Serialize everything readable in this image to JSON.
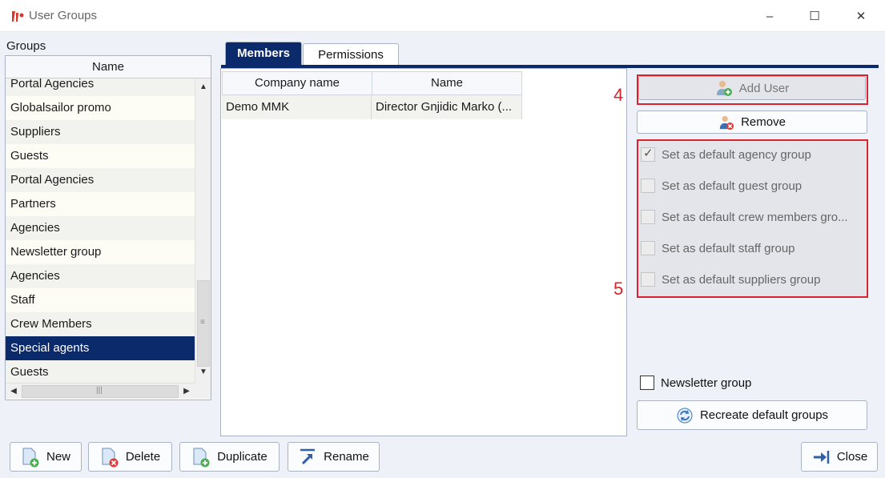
{
  "window": {
    "title": "User Groups",
    "minimize_glyph": "–",
    "maximize_glyph": "☐",
    "close_glyph": "✕"
  },
  "groups": {
    "label": "Groups",
    "column_header": "Name",
    "items": [
      {
        "label": "Portal Agencies",
        "selected": false
      },
      {
        "label": "Globalsailor promo",
        "selected": false
      },
      {
        "label": "Suppliers",
        "selected": false
      },
      {
        "label": "Guests",
        "selected": false
      },
      {
        "label": "Portal Agencies",
        "selected": false
      },
      {
        "label": "Partners",
        "selected": false
      },
      {
        "label": "Agencies",
        "selected": false
      },
      {
        "label": "Newsletter group",
        "selected": false
      },
      {
        "label": "Agencies",
        "selected": false
      },
      {
        "label": "Staff",
        "selected": false
      },
      {
        "label": "Crew Members",
        "selected": false
      },
      {
        "label": "Special agents",
        "selected": true
      },
      {
        "label": "Guests",
        "selected": false
      }
    ]
  },
  "tabs": [
    {
      "label": "Members",
      "active": true
    },
    {
      "label": "Permissions",
      "active": false
    }
  ],
  "members_table": {
    "columns": [
      "Company name",
      "Name"
    ],
    "rows": [
      [
        "Demo MMK",
        "Director Gnjidic Marko (..."
      ]
    ]
  },
  "actions": {
    "add_user": "Add User",
    "remove": "Remove",
    "annotation_4": "4",
    "annotation_5": "5"
  },
  "defaults": [
    {
      "label": "Set as default agency group",
      "checked": true
    },
    {
      "label": "Set as default guest group",
      "checked": false
    },
    {
      "label": "Set as default crew members gro...",
      "checked": false
    },
    {
      "label": "Set as default staff group",
      "checked": false
    },
    {
      "label": "Set as default suppliers group",
      "checked": false
    }
  ],
  "newsletter": {
    "label": "Newsletter group",
    "checked": false
  },
  "recreate_button": "Recreate default groups",
  "bottom_buttons": {
    "new": "New",
    "delete": "Delete",
    "duplicate": "Duplicate",
    "rename": "Rename",
    "close": "Close"
  },
  "colors": {
    "accent": "#0b2a6b",
    "annotation": "#d9232d",
    "selection": "#0b2a6b"
  }
}
